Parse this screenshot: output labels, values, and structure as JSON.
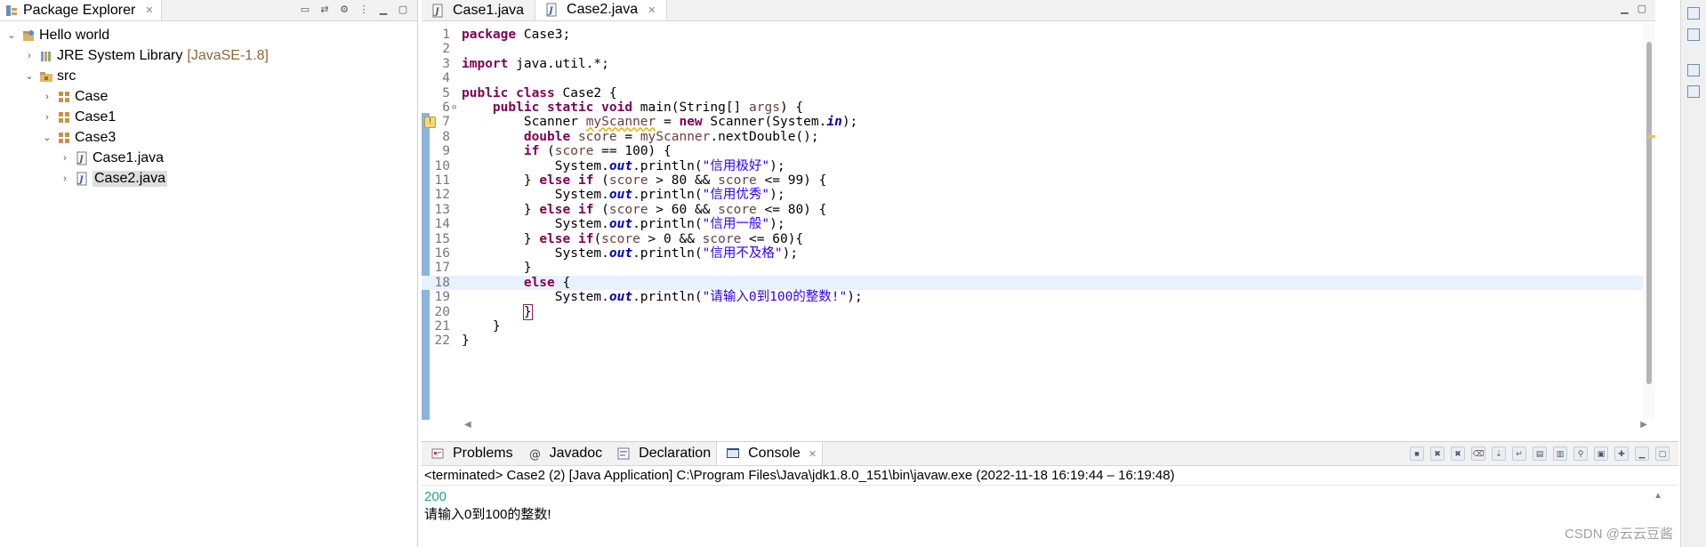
{
  "explorer": {
    "tab_label": "Package Explorer",
    "tree": [
      {
        "label": "Hello world",
        "arrow": "⌄",
        "indent": 6,
        "icon": "project-icon"
      },
      {
        "label": "JRE System Library",
        "suffix": "[JavaSE-1.8]",
        "arrow": "›",
        "indent": 26,
        "icon": "library-icon"
      },
      {
        "label": "src",
        "arrow": "⌄",
        "indent": 26,
        "icon": "source-folder-icon"
      },
      {
        "label": "Case",
        "arrow": "›",
        "indent": 46,
        "icon": "package-icon"
      },
      {
        "label": "Case1",
        "arrow": "›",
        "indent": 46,
        "icon": "package-icon"
      },
      {
        "label": "Case3",
        "arrow": "⌄",
        "indent": 46,
        "icon": "package-icon"
      },
      {
        "label": "Case1.java",
        "arrow": "›",
        "indent": 66,
        "icon": "java-file-icon"
      },
      {
        "label": "Case2.java",
        "arrow": "›",
        "indent": 66,
        "icon": "java-file-icon",
        "selected": true
      }
    ]
  },
  "editor": {
    "tabs": [
      {
        "label": "Case1.java",
        "active": false
      },
      {
        "label": "Case2.java",
        "active": true
      }
    ],
    "lines": [
      {
        "n": "1",
        "tokens": [
          {
            "t": "package ",
            "c": "kw"
          },
          {
            "t": "Case3;"
          }
        ]
      },
      {
        "n": "2",
        "tokens": []
      },
      {
        "n": "3",
        "tokens": [
          {
            "t": "import ",
            "c": "kw"
          },
          {
            "t": "java.util.*;"
          }
        ]
      },
      {
        "n": "4",
        "tokens": []
      },
      {
        "n": "5",
        "tokens": [
          {
            "t": "public ",
            "c": "kw"
          },
          {
            "t": "class ",
            "c": "kw"
          },
          {
            "t": "Case2 {"
          }
        ]
      },
      {
        "n": "6",
        "fold": "⊖",
        "tokens": [
          {
            "t": "    "
          },
          {
            "t": "public ",
            "c": "kw"
          },
          {
            "t": "static ",
            "c": "kw"
          },
          {
            "t": "void ",
            "c": "kw"
          },
          {
            "t": "main(String[] "
          },
          {
            "t": "args",
            "c": "var"
          },
          {
            "t": ") {"
          }
        ]
      },
      {
        "n": "7",
        "warning": true,
        "tokens": [
          {
            "t": "        Scanner "
          },
          {
            "t": "myScanner",
            "c": "warnvar"
          },
          {
            "t": " = "
          },
          {
            "t": "new ",
            "c": "kw"
          },
          {
            "t": "Scanner(System."
          },
          {
            "t": "in",
            "c": "fld"
          },
          {
            "t": ");"
          }
        ]
      },
      {
        "n": "8",
        "tokens": [
          {
            "t": "        "
          },
          {
            "t": "double ",
            "c": "kw"
          },
          {
            "t": "score",
            "c": "var"
          },
          {
            "t": " = "
          },
          {
            "t": "myScanner",
            "c": "var"
          },
          {
            "t": ".nextDouble();"
          }
        ]
      },
      {
        "n": "9",
        "tokens": [
          {
            "t": "        "
          },
          {
            "t": "if ",
            "c": "kw"
          },
          {
            "t": "("
          },
          {
            "t": "score",
            "c": "var"
          },
          {
            "t": " == 100) {"
          }
        ]
      },
      {
        "n": "10",
        "tokens": [
          {
            "t": "            System."
          },
          {
            "t": "out",
            "c": "fld"
          },
          {
            "t": ".println("
          },
          {
            "t": "\"信用极好\"",
            "c": "str"
          },
          {
            "t": ");"
          }
        ]
      },
      {
        "n": "11",
        "tokens": [
          {
            "t": "        } "
          },
          {
            "t": "else ",
            "c": "kw"
          },
          {
            "t": "if ",
            "c": "kw"
          },
          {
            "t": "("
          },
          {
            "t": "score",
            "c": "var"
          },
          {
            "t": " > 80 && "
          },
          {
            "t": "score",
            "c": "var"
          },
          {
            "t": " <= 99) {"
          }
        ]
      },
      {
        "n": "12",
        "tokens": [
          {
            "t": "            System."
          },
          {
            "t": "out",
            "c": "fld"
          },
          {
            "t": ".println("
          },
          {
            "t": "\"信用优秀\"",
            "c": "str"
          },
          {
            "t": ");"
          }
        ]
      },
      {
        "n": "13",
        "tokens": [
          {
            "t": "        } "
          },
          {
            "t": "else ",
            "c": "kw"
          },
          {
            "t": "if ",
            "c": "kw"
          },
          {
            "t": "("
          },
          {
            "t": "score",
            "c": "var"
          },
          {
            "t": " > 60 && "
          },
          {
            "t": "score",
            "c": "var"
          },
          {
            "t": " <= 80) {"
          }
        ]
      },
      {
        "n": "14",
        "tokens": [
          {
            "t": "            System."
          },
          {
            "t": "out",
            "c": "fld"
          },
          {
            "t": ".println("
          },
          {
            "t": "\"信用一般\"",
            "c": "str"
          },
          {
            "t": ");"
          }
        ]
      },
      {
        "n": "15",
        "tokens": [
          {
            "t": "        } "
          },
          {
            "t": "else ",
            "c": "kw"
          },
          {
            "t": "if",
            "c": "kw"
          },
          {
            "t": "("
          },
          {
            "t": "score",
            "c": "var"
          },
          {
            "t": " > 0 && "
          },
          {
            "t": "score",
            "c": "var"
          },
          {
            "t": " <= 60){"
          }
        ]
      },
      {
        "n": "16",
        "tokens": [
          {
            "t": "            System."
          },
          {
            "t": "out",
            "c": "fld"
          },
          {
            "t": ".println("
          },
          {
            "t": "\"信用不及格\"",
            "c": "str"
          },
          {
            "t": ");"
          }
        ]
      },
      {
        "n": "17",
        "tokens": [
          {
            "t": "        }"
          }
        ]
      },
      {
        "n": "18",
        "current": true,
        "tokens": [
          {
            "t": "        "
          },
          {
            "t": "else ",
            "c": "kw"
          },
          {
            "t": "{"
          }
        ]
      },
      {
        "n": "19",
        "tokens": [
          {
            "t": "            System."
          },
          {
            "t": "out",
            "c": "fld"
          },
          {
            "t": ".println("
          },
          {
            "t": "\"请输入0到100的整数!\"",
            "c": "str"
          },
          {
            "t": ");"
          }
        ]
      },
      {
        "n": "20",
        "tokens": [
          {
            "t": "        "
          },
          {
            "t": "}",
            "c": "brace-box"
          }
        ]
      },
      {
        "n": "21",
        "tokens": [
          {
            "t": "    }"
          }
        ]
      },
      {
        "n": "22",
        "tokens": [
          {
            "t": "}"
          }
        ]
      }
    ]
  },
  "console": {
    "tabs": [
      {
        "label": "Problems",
        "icon": "problems-icon"
      },
      {
        "label": "Javadoc",
        "icon": "javadoc-icon"
      },
      {
        "label": "Declaration",
        "icon": "declaration-icon"
      },
      {
        "label": "Console",
        "icon": "console-icon",
        "active": true
      }
    ],
    "status": "<terminated> Case2 (2) [Java Application] C:\\Program Files\\Java\\jdk1.8.0_151\\bin\\javaw.exe  (2022-11-18 16:19:44 – 16:19:48)",
    "input_line": "200",
    "output_line": "请输入0到100的整数!",
    "watermark": "CSDN @云云豆酱"
  },
  "colors": {
    "keyword": "#7f0055",
    "string": "#2a00ff",
    "field": "#0000c0",
    "local_var": "#6a3e3e",
    "console_input": "#1fa589",
    "current_line": "#e8f2fe"
  }
}
